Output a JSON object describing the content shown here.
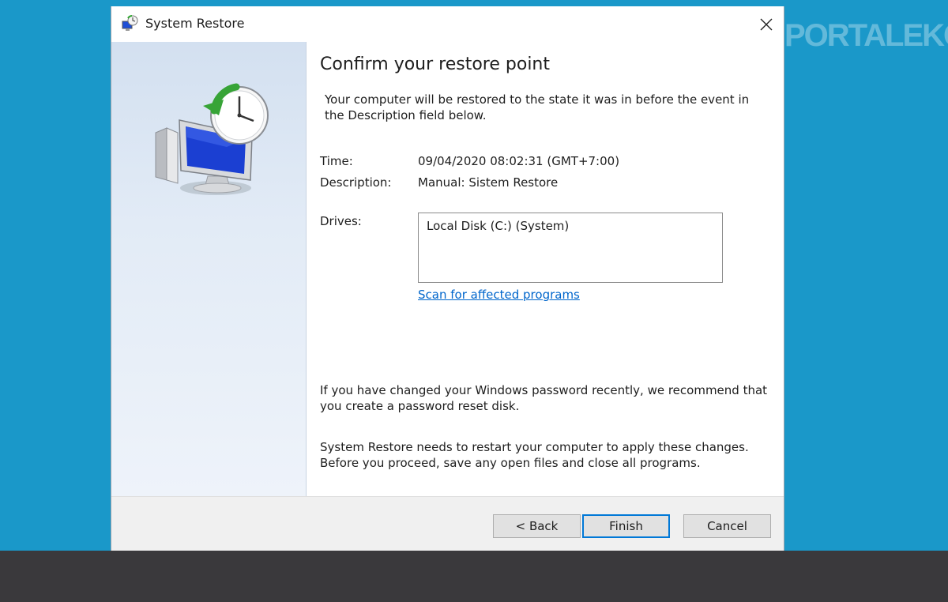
{
  "window": {
    "title": "System Restore"
  },
  "watermark": {
    "text": "PORTALEKONOMI"
  },
  "icons": {
    "app": "system-restore-icon",
    "close": "close-icon",
    "hero": "system-restore-hero-icon"
  },
  "content": {
    "heading": "Confirm your restore point",
    "intro": "Your computer will be restored to the state it was in before the event in the Description field below.",
    "time_label": "Time:",
    "time_value": "09/04/2020 08:02:31 (GMT+7:00)",
    "description_label": "Description:",
    "description_value": "Manual: Sistem Restore",
    "drives_label": "Drives:",
    "drives": [
      "Local Disk (C:) (System)"
    ],
    "scan_link": "Scan for affected programs",
    "password_note": "If you have changed your Windows password recently, we recommend that you create a password reset disk.",
    "restart_note": "System Restore needs to restart your computer to apply these changes. Before you proceed, save any open files and close all programs."
  },
  "buttons": {
    "back": "< Back",
    "finish": "Finish",
    "cancel": "Cancel"
  },
  "colors": {
    "desktop": "#1a98c9",
    "link": "#0066cc",
    "accent": "#0078d7",
    "taskbar": "#3a393c"
  }
}
